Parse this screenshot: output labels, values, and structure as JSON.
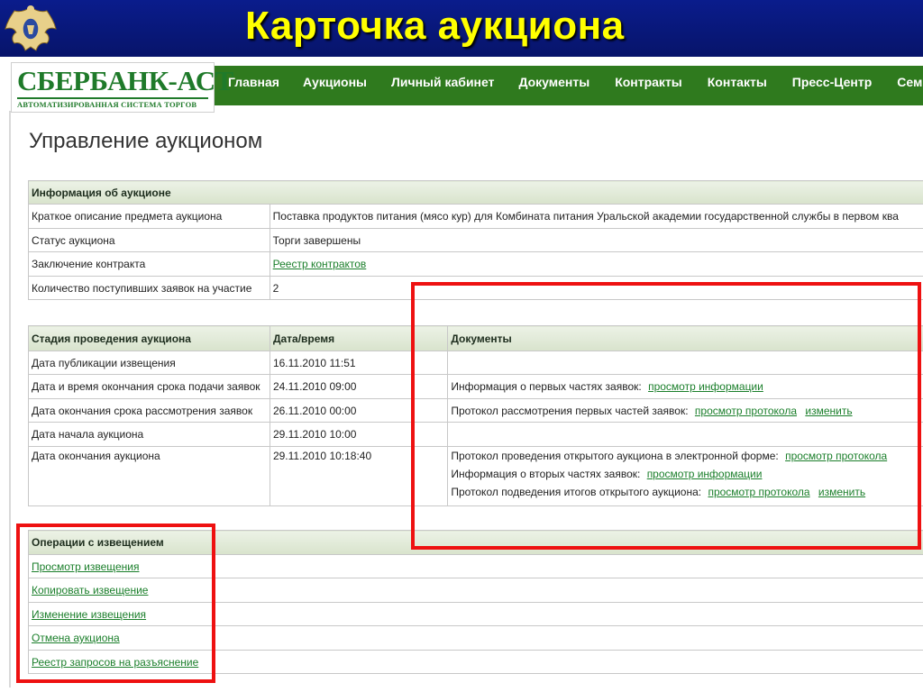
{
  "slide": {
    "title": "Карточка аукциона"
  },
  "site": {
    "logo": {
      "main": "СБЕРБАНК-АСТ",
      "sub": "АВТОМАТИЗИРОВАННАЯ СИСТЕМА ТОРГОВ"
    },
    "nav": [
      "Главная",
      "Аукционы",
      "Личный кабинет",
      "Документы",
      "Контракты",
      "Контакты",
      "Пресс-Центр",
      "Семинары"
    ]
  },
  "page": {
    "title": "Управление аукционом"
  },
  "info": {
    "header": "Информация об аукционе",
    "rows": [
      {
        "label": "Краткое описание предмета аукциона",
        "value": "Поставка продуктов питания (мясо кур) для Комбината питания Уральской академии государственной службы в первом ква"
      },
      {
        "label": "Статус аукциона",
        "value": "Торги завершены"
      },
      {
        "label": "Заключение контракта",
        "value": "Реестр контрактов"
      },
      {
        "label": "Количество поступивших заявок на участие",
        "value": "2"
      }
    ]
  },
  "stages": {
    "headers": {
      "stage": "Стадия проведения аукциона",
      "date": "Дата/время",
      "docs": "Документы"
    },
    "rows": [
      {
        "stage": "Дата публикации извещения",
        "date": "16.11.2010 11:51"
      },
      {
        "stage": "Дата и время окончания срока подачи заявок",
        "date": "24.11.2010 09:00",
        "doc_text": "Информация о первых частях заявок:",
        "doc_link": "просмотр информации"
      },
      {
        "stage": "Дата окончания срока рассмотрения заявок",
        "date": "26.11.2010 00:00",
        "doc_text": "Протокол рассмотрения первых частей заявок:",
        "doc_link": "просмотр протокола",
        "doc_link2": "изменить"
      },
      {
        "stage": "Дата начала аукциона",
        "date": "29.11.2010 10:00"
      },
      {
        "stage": "Дата окончания аукциона",
        "date": "29.11.2010 10:18:40",
        "docs": [
          {
            "text": "Протокол проведения открытого аукциона в электронной форме:",
            "link": "просмотр протокола"
          },
          {
            "text": "Информация о вторых частях заявок:",
            "link": "просмотр информации"
          },
          {
            "text": "Протокол подведения итогов открытого аукциона:",
            "link": "просмотр протокола",
            "link2": "изменить"
          }
        ]
      }
    ]
  },
  "operations": {
    "header": "Операции с извещением",
    "links": [
      "Просмотр извещения",
      "Копировать извещение",
      "Изменение извещения",
      "Отмена аукциона",
      "Реестр запросов на разъяснение"
    ]
  },
  "colors": {
    "slide_bg": "#0a1c8c",
    "title": "#ffff00",
    "nav_green": "#2f7a1e",
    "link": "#1b7f2b",
    "highlight": "#ee1111"
  }
}
